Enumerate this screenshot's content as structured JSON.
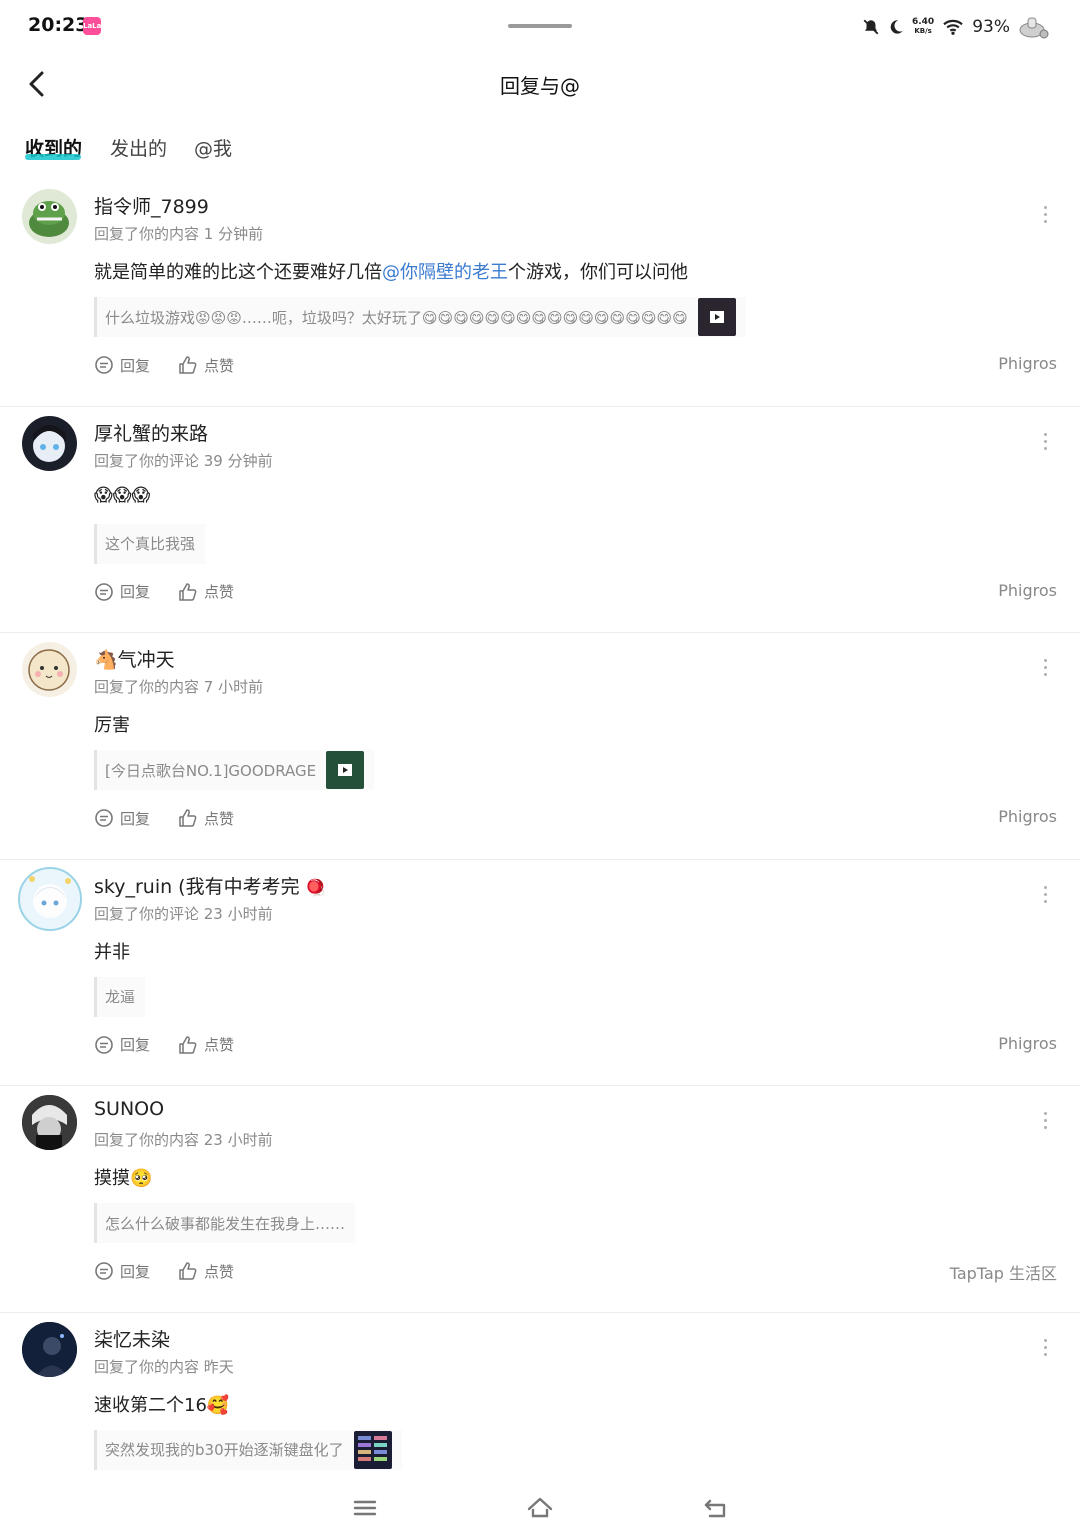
{
  "status_bar": {
    "time": "20:23",
    "app_badge": "LaLa",
    "speed_value": "6.40",
    "speed_unit": "KB/s",
    "battery": "93%"
  },
  "header": {
    "title": "回复与@"
  },
  "tabs": [
    {
      "label": "收到的",
      "active": true
    },
    {
      "label": "发出的",
      "active": false
    },
    {
      "label": "@我",
      "active": false
    }
  ],
  "actions": {
    "reply": "回复",
    "like": "点赞"
  },
  "items": [
    {
      "name": "指令师_7899",
      "meta": "回复了你的内容 1 分钟前",
      "content_before": "就是简单的难的比这个还要难好几倍",
      "mention": "@你隔壁的老王",
      "content_after": "个游戏，你们可以问他",
      "quote": "什么垃圾游戏😡😡😡……呃，垃圾吗？太好玩了😋😋😋😋😋😋😋😋😋😋😋😋😋😋😋😋😋",
      "source": "Phigros"
    },
    {
      "name": "厚礼蟹的来路",
      "meta": "回复了你的评论 39 分钟前",
      "content": "😱😱😱",
      "quote": "这个真比我强",
      "source": "Phigros"
    },
    {
      "name": "🐴气冲天",
      "meta": "回复了你的内容 7 小时前",
      "content": "厉害",
      "quote": "[今日点歌台NO.1]GOODRAGE",
      "source": "Phigros"
    },
    {
      "name": "sky_ruin (我有中考考完",
      "badge": "🪀",
      "meta": "回复了你的评论 23 小时前",
      "content": "并非",
      "quote": "龙逼",
      "source": "Phigros"
    },
    {
      "name": "SUNOO",
      "meta": "回复了你的内容 23 小时前",
      "content": "摸摸🥺",
      "quote": "怎么什么破事都能发生在我身上……",
      "source": "TapTap 生活区"
    },
    {
      "name": "柒忆未染",
      "meta": "回复了你的内容 昨天",
      "content": "速收第二个16🥰",
      "quote": "突然发现我的b30开始逐渐键盘化了",
      "source": ""
    }
  ]
}
